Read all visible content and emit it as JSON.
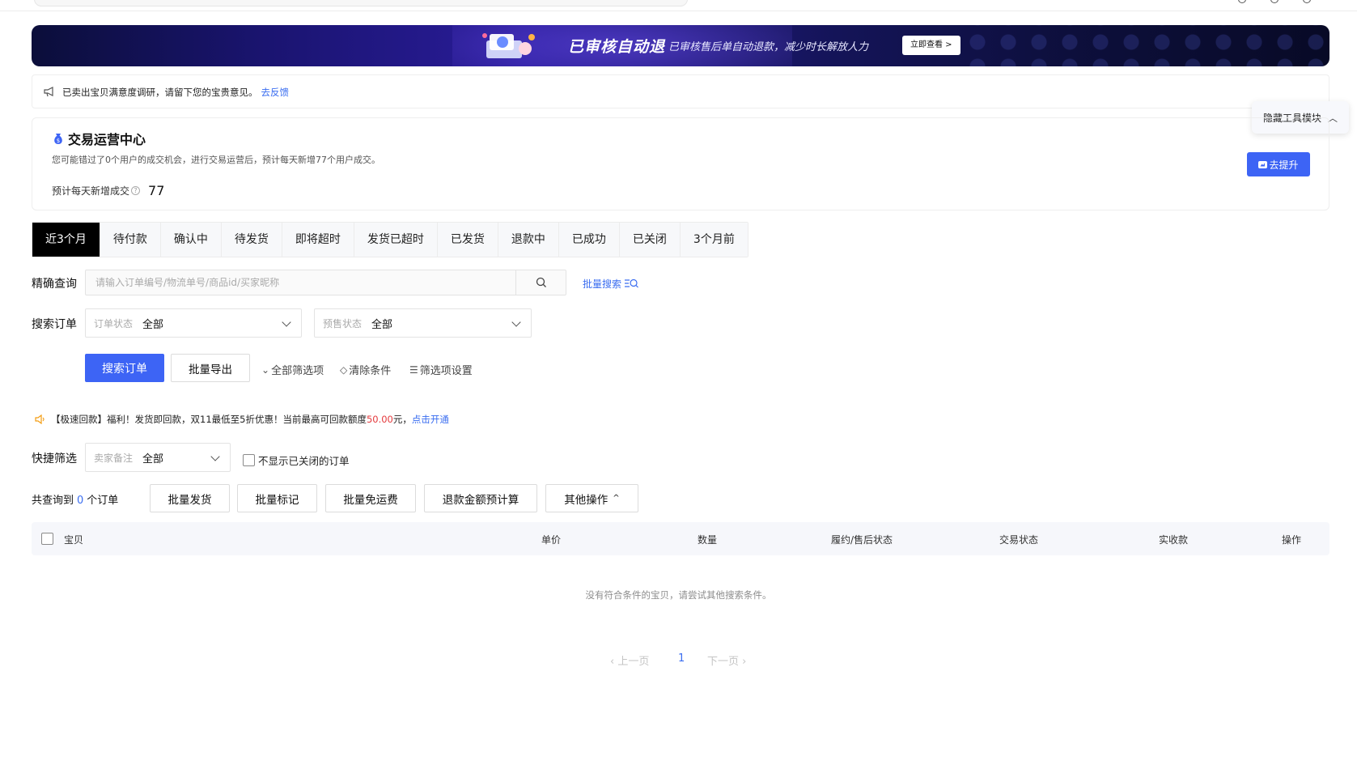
{
  "banner": {
    "title": "已审核自动退",
    "description": "已审核售后单自动退款，减少时长解放人力",
    "cta": "立即查看 >"
  },
  "notice": {
    "text": "已卖出宝贝满意度调研，请留下您的宝贵意见。",
    "link": "去反馈"
  },
  "ops_center": {
    "title": "交易运营中心",
    "subtitle": "您可能错过了0个用户的成交机会，进行交易运营后，预计每天新增77个用户成交。",
    "metric_label": "预计每天新增成交",
    "metric_value": "77",
    "button": "去提升"
  },
  "hide_panel": {
    "label": "隐藏工具模块"
  },
  "tabs": [
    {
      "label": "近3个月",
      "active": true
    },
    {
      "label": "待付款"
    },
    {
      "label": "确认中"
    },
    {
      "label": "待发货"
    },
    {
      "label": "即将超时"
    },
    {
      "label": "发货已超时"
    },
    {
      "label": "已发货"
    },
    {
      "label": "退款中"
    },
    {
      "label": "已成功"
    },
    {
      "label": "已关闭"
    },
    {
      "label": "3个月前"
    }
  ],
  "query": {
    "precise_label": "精确查询",
    "search_placeholder": "请输入订单编号/物流单号/商品id/买家昵称",
    "batch_search": "批量搜索",
    "search_orders_label": "搜索订单",
    "order_status": {
      "key": "订单状态",
      "value": "全部"
    },
    "presale_status": {
      "key": "预售状态",
      "value": "全部"
    },
    "search_button": "搜索订单",
    "export_button": "批量导出",
    "all_filters": "全部筛选项",
    "clear": "清除条件",
    "filter_settings": "筛选项设置"
  },
  "promo": {
    "prefix": "【极速回款】福利！发货即回款，双11最低至5折优惠！当前最高可回款额度",
    "amount": "50.00",
    "suffix": "元，",
    "link": "点击开通"
  },
  "quick_filter": {
    "label": "快捷筛选",
    "seller_note": {
      "key": "卖家备注",
      "value": "全部"
    },
    "hide_closed": "不显示已关闭的订单"
  },
  "results": {
    "prefix": "共查询到",
    "count": "0",
    "suffix": "个订单",
    "actions": [
      "批量发货",
      "批量标记",
      "批量免运费",
      "退款金额预计算",
      "其他操作"
    ]
  },
  "table": {
    "columns": [
      "宝贝",
      "单价",
      "数量",
      "履约/售后状态",
      "交易状态",
      "实收款",
      "操作"
    ],
    "empty": "没有符合条件的宝贝，请尝试其他搜索条件。"
  },
  "pagination": {
    "prev": "上一页",
    "current": "1",
    "next": "下一页"
  },
  "colors": {
    "primary": "#3d64f5",
    "link": "#3a6df0",
    "highlight": "#e4393c",
    "active_tab": "#000000"
  }
}
